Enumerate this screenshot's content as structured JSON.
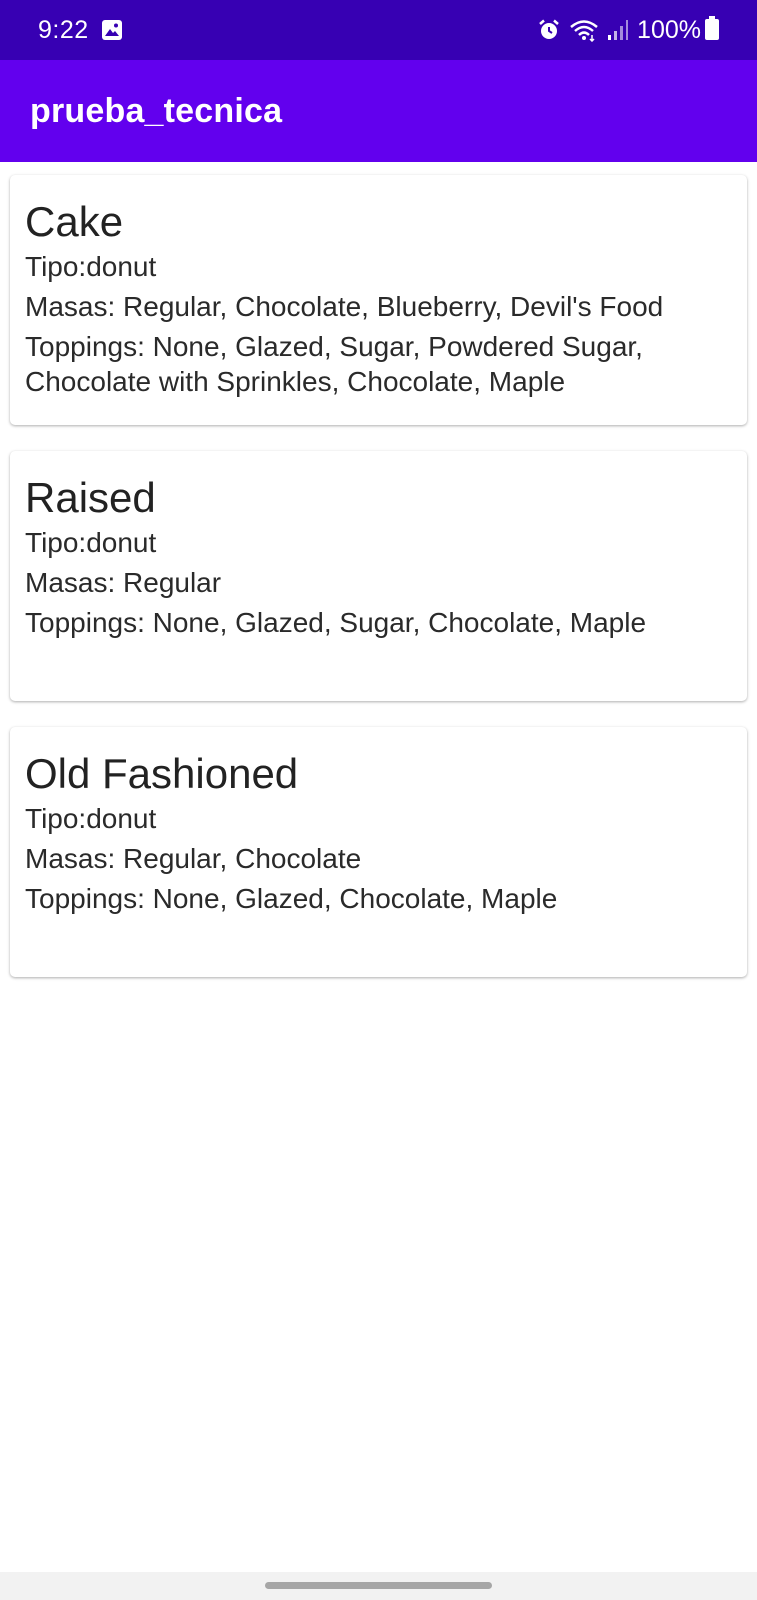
{
  "status_bar": {
    "time": "9:22",
    "battery": "100%",
    "icons": [
      "gallery-icon",
      "alarm-icon",
      "wifi-icon",
      "signal-icon",
      "battery-icon"
    ]
  },
  "app_bar": {
    "title": "prueba_tecnica",
    "color": "#6200ee",
    "status_color": "#3700b3"
  },
  "cards": [
    {
      "title": "Cake",
      "tipo": "Tipo:donut",
      "masas": "Masas: Regular, Chocolate, Blueberry, Devil's Food",
      "toppings": "Toppings: None, Glazed, Sugar, Powdered Sugar, Chocolate with Sprinkles, Chocolate, Maple"
    },
    {
      "title": "Raised",
      "tipo": "Tipo:donut",
      "masas": "Masas: Regular",
      "toppings": "Toppings: None, Glazed, Sugar, Chocolate, Maple"
    },
    {
      "title": "Old Fashioned",
      "tipo": "Tipo:donut",
      "masas": "Masas: Regular, Chocolate",
      "toppings": "Toppings: None, Glazed, Chocolate, Maple"
    }
  ]
}
